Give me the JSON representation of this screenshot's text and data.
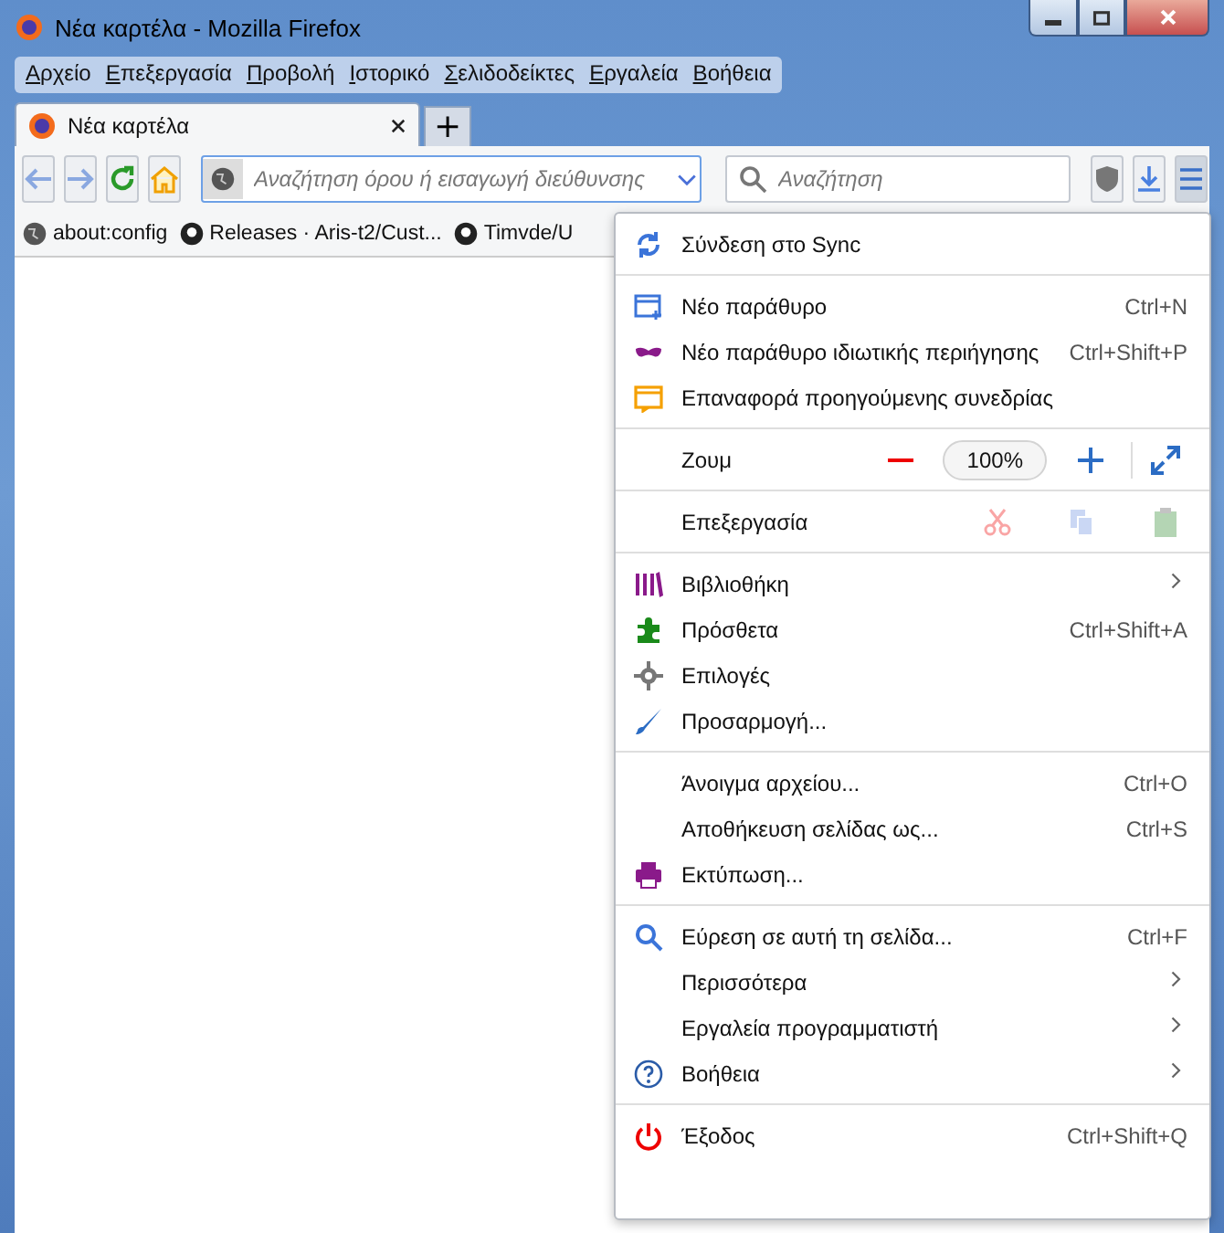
{
  "window": {
    "title": "Νέα καρτέλα - Mozilla Firefox"
  },
  "menubar": [
    "Αρχείο",
    "Επεξεργασία",
    "Προβολή",
    "Ιστορικό",
    "Σελιδοδείκτες",
    "Εργαλεία",
    "Βοήθεια"
  ],
  "tabs": [
    {
      "label": "Νέα καρτέλα",
      "selected": true
    }
  ],
  "new_tab": "+",
  "urlbar": {
    "placeholder": "Αναζήτηση όρου ή εισαγωγή διεύθυνσης"
  },
  "searchbar": {
    "placeholder": "Αναζήτηση"
  },
  "bookmarks": [
    "about:config",
    "Releases · Aris-t2/Cust...",
    "Timvde/U"
  ],
  "app_menu": [
    [
      {
        "kind": "item",
        "label": "Σύνδεση στο Sync",
        "submenu": false
      }
    ],
    [
      {
        "kind": "item",
        "label": "Νέο παράθυρο",
        "shortcut": "Ctrl+N",
        "submenu": false
      },
      {
        "kind": "item",
        "label": "Νέο παράθυρο ιδιωτικής περιήγησης",
        "shortcut": "Ctrl+Shift+P",
        "submenu": false
      },
      {
        "kind": "item",
        "label": "Επαναφορά προηγούμενης συνεδρίας",
        "submenu": false
      }
    ],
    [
      {
        "kind": "zoom",
        "label": "Ζουμ",
        "value": "100%"
      }
    ],
    [
      {
        "kind": "edit",
        "label": "Επεξεργασία",
        "disabled": true
      }
    ],
    [
      {
        "kind": "item",
        "label": "Βιβλιοθήκη",
        "submenu": true
      },
      {
        "kind": "item",
        "label": "Πρόσθετα",
        "shortcut": "Ctrl+Shift+A",
        "submenu": false
      },
      {
        "kind": "item",
        "label": "Επιλογές",
        "submenu": false
      },
      {
        "kind": "item",
        "label": "Προσαρμογή...",
        "submenu": false
      }
    ],
    [
      {
        "kind": "item",
        "label": "Άνοιγμα αρχείου...",
        "shortcut": "Ctrl+O",
        "submenu": false
      },
      {
        "kind": "item",
        "label": "Αποθήκευση σελίδας ως...",
        "shortcut": "Ctrl+S",
        "submenu": false
      },
      {
        "kind": "item",
        "label": "Εκτύπωση...",
        "submenu": false
      }
    ],
    [
      {
        "kind": "item",
        "label": "Εύρεση σε αυτή τη σελίδα...",
        "shortcut": "Ctrl+F",
        "submenu": false
      },
      {
        "kind": "item",
        "label": "Περισσότερα",
        "submenu": true
      },
      {
        "kind": "item",
        "label": "Εργαλεία προγραμματιστή",
        "submenu": true
      },
      {
        "kind": "item",
        "label": "Βοήθεια",
        "submenu": true
      }
    ],
    [
      {
        "kind": "item",
        "label": "Έξοδος",
        "shortcut": "Ctrl+Shift+Q",
        "submenu": false
      }
    ]
  ]
}
